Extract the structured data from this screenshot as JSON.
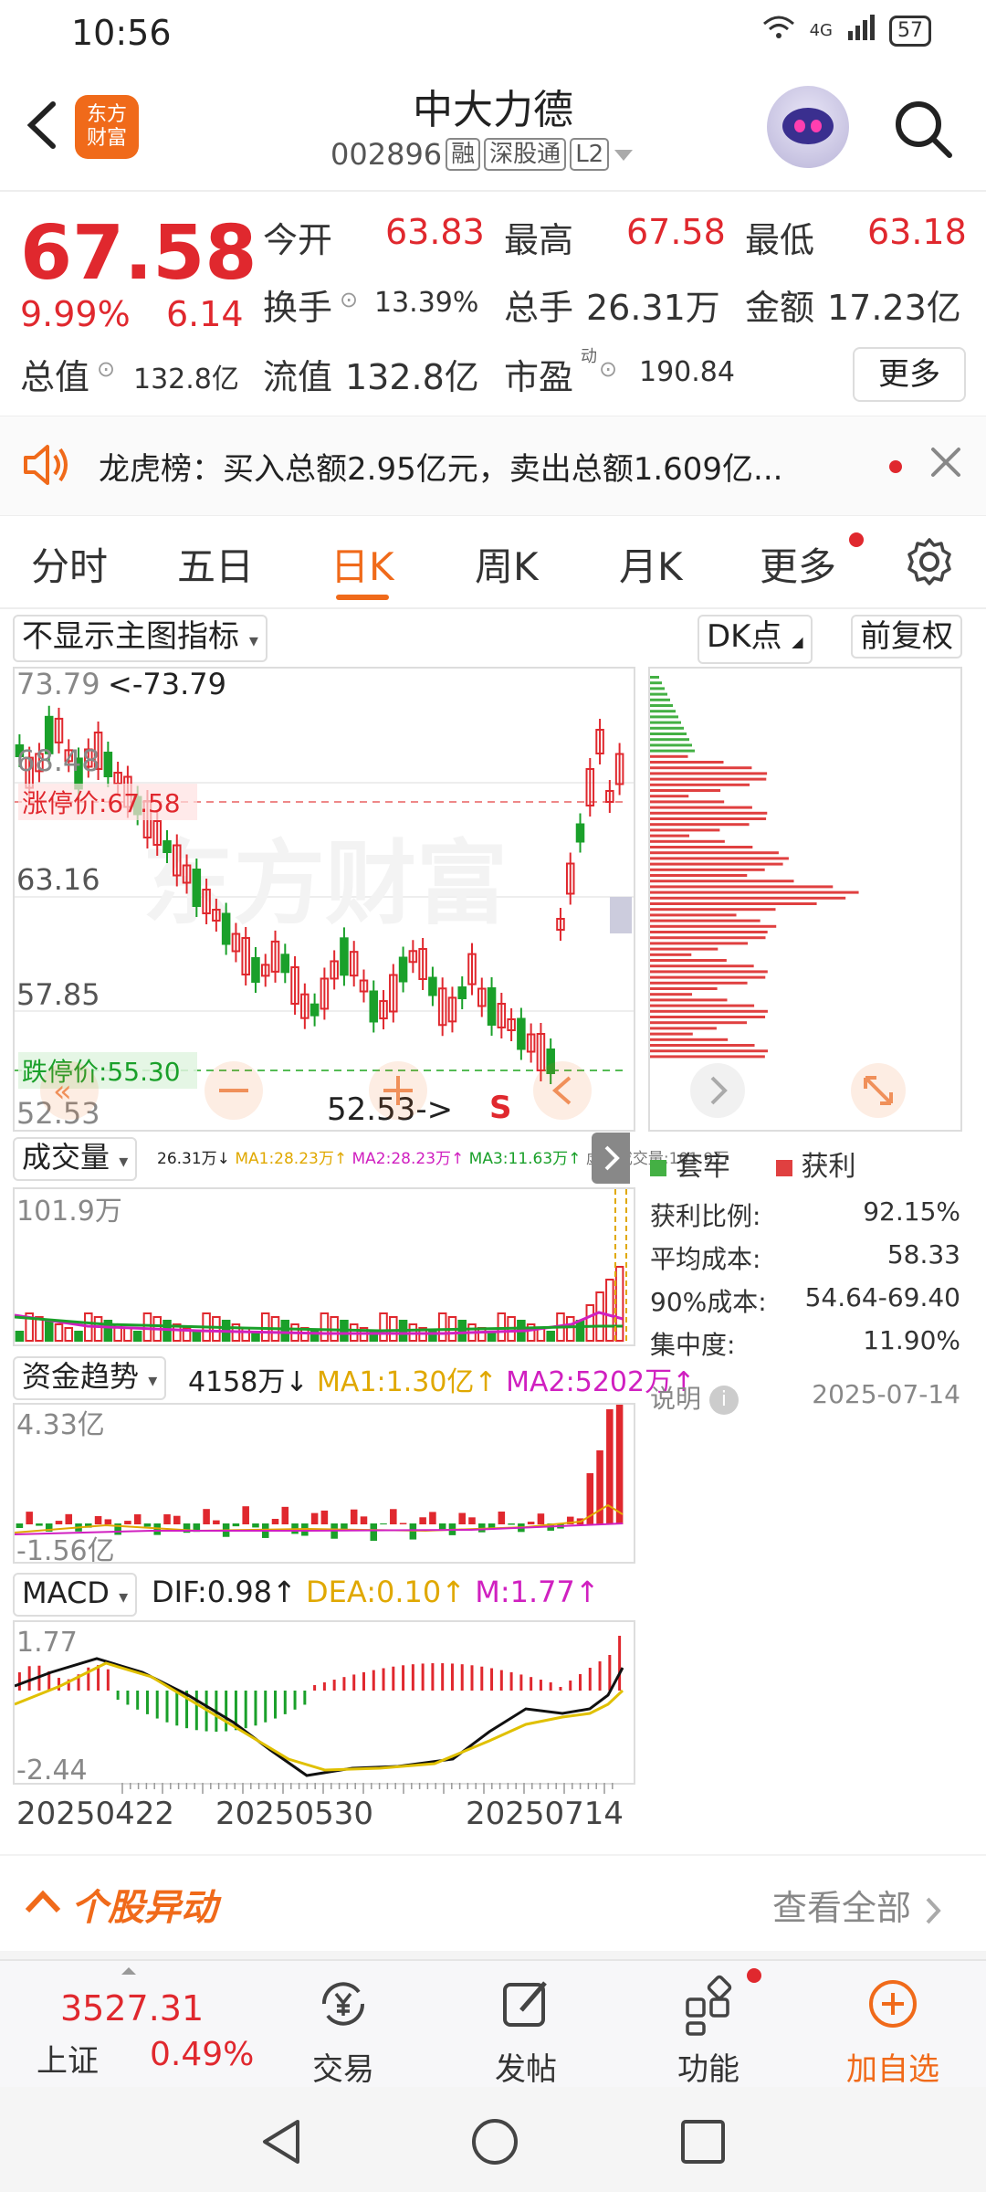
{
  "status": {
    "time": "10:56",
    "network": "4G",
    "battery": "57"
  },
  "header": {
    "stock_name": "中大力德",
    "stock_code": "002896",
    "tags": [
      "融",
      "深股通",
      "L2"
    ],
    "logo_text_1": "东方",
    "logo_text_2": "财富"
  },
  "quote": {
    "price": "67.58",
    "change_pct": "9.99%",
    "change": "6.14",
    "open_label": "今开",
    "open": "63.83",
    "high_label": "最高",
    "high": "67.58",
    "low_label": "最低",
    "low": "63.18",
    "turnover_label": "换手",
    "turnover": "13.39%",
    "volume_label": "总手",
    "volume": "26.31万",
    "amount_label": "金额",
    "amount": "17.23亿",
    "mktcap_label": "总值",
    "mktcap": "132.8亿",
    "float_label": "流值",
    "float": "132.8亿",
    "pe_label": "市盈",
    "pe_sup": "动",
    "pe": "190.84",
    "more_label": "更多"
  },
  "banner": {
    "text": "龙虎榜：买入总额2.95亿元，卖出总额1.609亿..."
  },
  "tabs": [
    "分时",
    "五日",
    "日K",
    "周K",
    "月K",
    "更多"
  ],
  "active_tab": "日K",
  "kline": {
    "indicator_select": "不显示主图指标",
    "dk_label": "DK点",
    "adjust_label": "前复权",
    "y_ticks": [
      "73.79",
      "68.48",
      "63.16",
      "57.85",
      "52.53"
    ],
    "max_label": "<-73.79",
    "min_label": "52.53->",
    "limit_up_label": "涨停价:67.58",
    "limit_down_label": "跌停价:55.30",
    "s_marker": "S",
    "watermark": "东方财富"
  },
  "volume": {
    "select": "成交量",
    "info": "26.31万↓",
    "ma1": "MA1:28.23万↑",
    "ma2": "MA2:28.23万↑",
    "ma3": "MA3:11.63万↑",
    "virtual": "虚拟成交量:101.9万",
    "top_label": "101.9万"
  },
  "capital": {
    "select": "资金趋势",
    "value": "4158万↓",
    "ma1": "MA1:1.30亿↑",
    "ma2": "MA2:5202万↑",
    "top_label": "4.33亿",
    "bottom_label": "-1.56亿"
  },
  "macd": {
    "select": "MACD",
    "dif": "DIF:0.98↑",
    "dea": "DEA:0.10↑",
    "m": "M:1.77↑",
    "top_label": "1.77",
    "bottom_label": "-2.44"
  },
  "x_labels": [
    "20250422",
    "20250530",
    "20250714"
  ],
  "chip": {
    "legend_trapped": "套牢",
    "legend_profit": "获利",
    "stats": [
      {
        "label": "获利比例:",
        "value": "92.15%"
      },
      {
        "label": "平均成本:",
        "value": "58.33"
      },
      {
        "label": "90%成本:",
        "value": "54.64-69.40"
      },
      {
        "label": "集中度:",
        "value": "11.90%"
      }
    ],
    "explain_label": "说明",
    "date": "2025-07-14"
  },
  "section": {
    "title": "个股异动",
    "view_all": "查看全部"
  },
  "bottom_nav": {
    "index_value": "3527.31",
    "index_name": "上证",
    "index_pct": "0.49%",
    "items": [
      "交易",
      "发帖",
      "功能",
      "加自选"
    ]
  },
  "colors": {
    "up": "#e0282e",
    "down": "#1aa02a",
    "accent": "#f06a1a"
  }
}
